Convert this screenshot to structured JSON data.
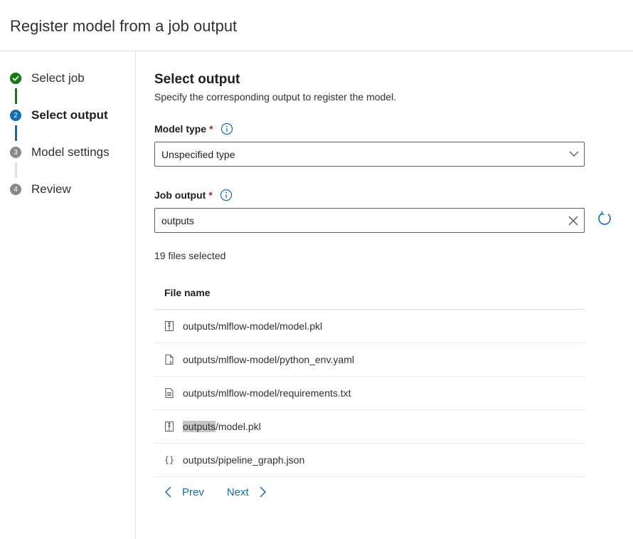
{
  "header": {
    "title": "Register model from a job output"
  },
  "steps": [
    {
      "number": "",
      "label": "Select job",
      "state": "done"
    },
    {
      "number": "2",
      "label": "Select output",
      "state": "current"
    },
    {
      "number": "3",
      "label": "Model settings",
      "state": "pending"
    },
    {
      "number": "4",
      "label": "Review",
      "state": "pending"
    }
  ],
  "section": {
    "title": "Select output",
    "subtitle": "Specify the corresponding output to register the model."
  },
  "model_type": {
    "label": "Model type",
    "required_mark": "*",
    "value": "Unspecified type"
  },
  "job_output": {
    "label": "Job output",
    "required_mark": "*",
    "value": "outputs"
  },
  "files_selected": "19 files selected",
  "table": {
    "header": "File name",
    "rows": [
      {
        "icon": "package-icon",
        "prefix": "outputs",
        "rest": "/mlflow-model/model.pkl",
        "highlight": false
      },
      {
        "icon": "yaml-file-icon",
        "prefix": "outputs",
        "rest": "/mlflow-model/python_env.yaml",
        "highlight": false
      },
      {
        "icon": "text-file-icon",
        "prefix": "outputs",
        "rest": "/mlflow-model/requirements.txt",
        "highlight": false
      },
      {
        "icon": "package-icon",
        "prefix": "outputs",
        "rest": "/model.pkl",
        "highlight": true
      },
      {
        "icon": "json-braces-icon",
        "prefix": "outputs",
        "rest": "/pipeline_graph.json",
        "highlight": false
      }
    ]
  },
  "pager": {
    "prev": "Prev",
    "next": "Next"
  },
  "colors": {
    "accent": "#0f6cbd",
    "success": "#107c10",
    "required": "#a4262c"
  }
}
